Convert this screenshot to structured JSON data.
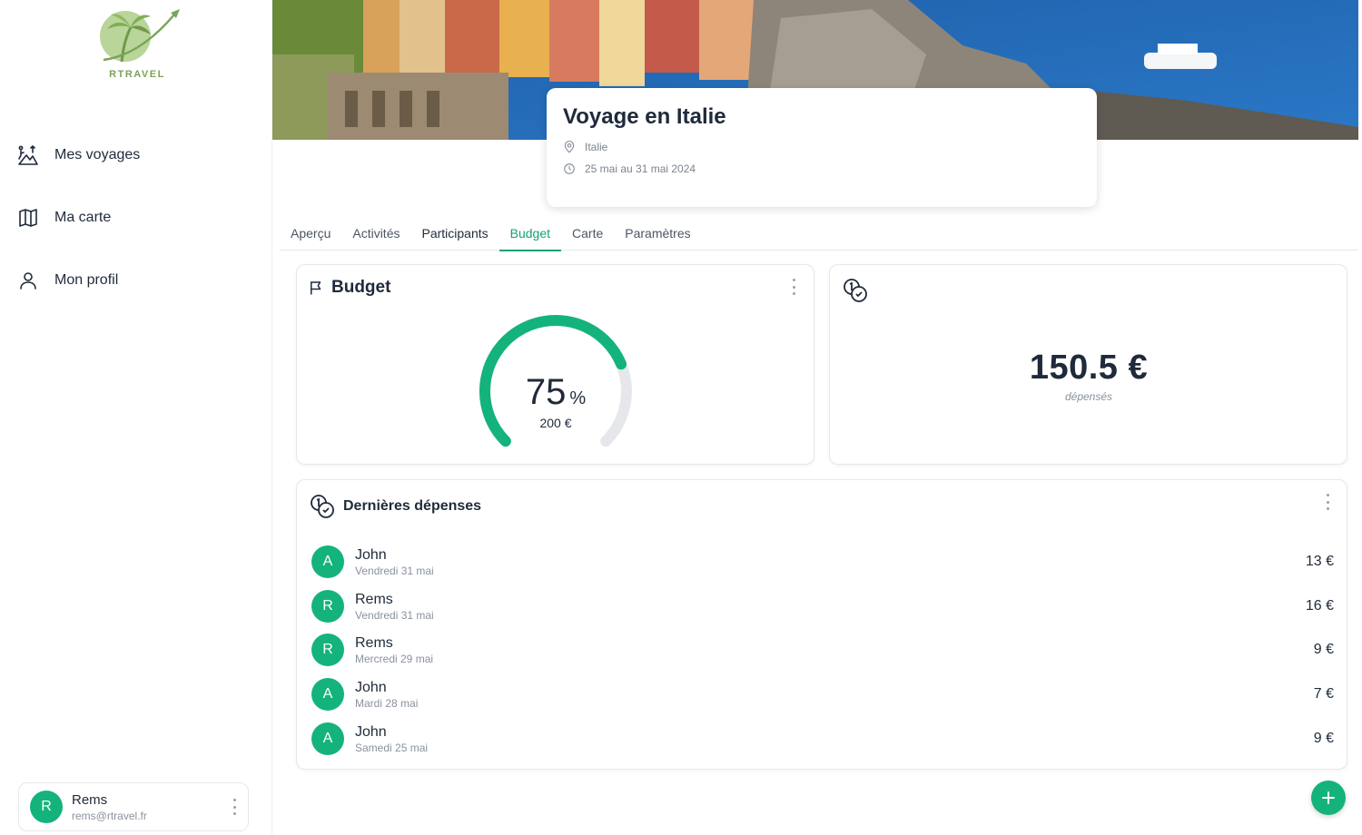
{
  "brand": {
    "name": "RTRAVEL",
    "color": "#7aa45a"
  },
  "colors": {
    "accent": "#14b37c",
    "text": "#1f2a3a",
    "muted": "#8a929d"
  },
  "sidebar": {
    "items": [
      {
        "label": "Mes voyages",
        "icon": "hiker-mountain-icon"
      },
      {
        "label": "Ma carte",
        "icon": "map-icon"
      },
      {
        "label": "Mon profil",
        "icon": "user-icon"
      }
    ],
    "user": {
      "initial": "R",
      "name": "Rems",
      "email": "rems@rtravel.fr"
    }
  },
  "trip": {
    "title": "Voyage en Italie",
    "location": "Italie",
    "dates": "25 mai au 31 mai 2024"
  },
  "tabs": [
    {
      "label": "Aperçu"
    },
    {
      "label": "Activités"
    },
    {
      "label": "Participants"
    },
    {
      "label": "Budget",
      "active": true
    },
    {
      "label": "Carte"
    },
    {
      "label": "Paramètres"
    }
  ],
  "budget_card": {
    "title": "Budget",
    "icon": "flag-icon",
    "percent": "75",
    "percent_symbol": "%",
    "percent_value": 0.75,
    "total": "200 €"
  },
  "spent_card": {
    "icon": "coins-icon",
    "amount": "150.5 €",
    "label": "dépensés"
  },
  "expenses": {
    "title": "Dernières dépenses",
    "icon": "coins-icon",
    "items": [
      {
        "initial": "A",
        "name": "John",
        "date": "Vendredi 31 mai",
        "amount": "13 €"
      },
      {
        "initial": "R",
        "name": "Rems",
        "date": "Vendredi 31 mai",
        "amount": "16 €"
      },
      {
        "initial": "R",
        "name": "Rems",
        "date": "Mercredi 29 mai",
        "amount": "9 €"
      },
      {
        "initial": "A",
        "name": "John",
        "date": "Mardi 28 mai",
        "amount": "7 €"
      },
      {
        "initial": "A",
        "name": "John",
        "date": "Samedi 25 mai",
        "amount": "9 €"
      }
    ]
  },
  "fab": {
    "icon": "plus-icon"
  }
}
